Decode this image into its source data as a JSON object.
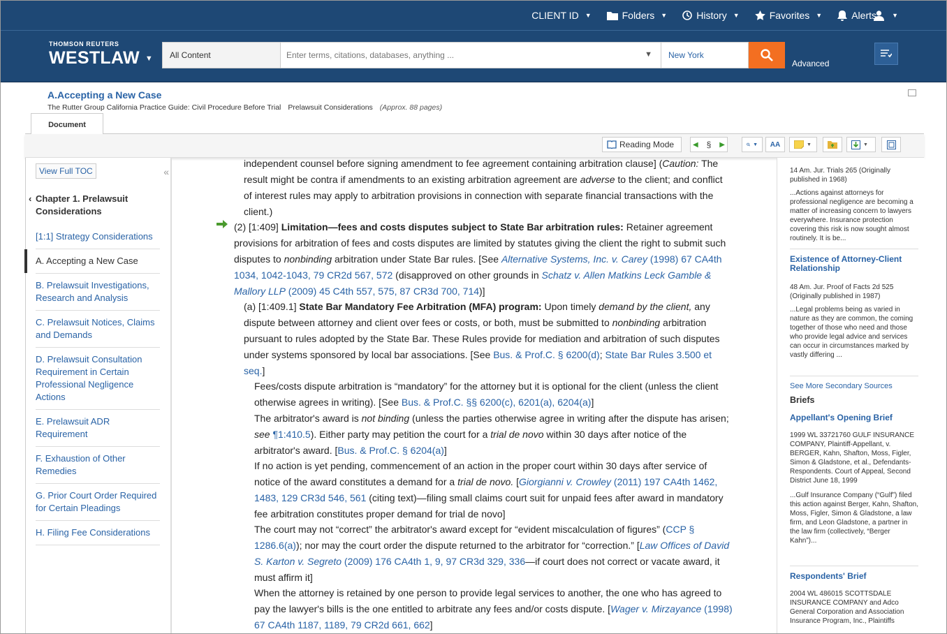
{
  "topnav": {
    "client_id": "CLIENT ID",
    "folders": "Folders",
    "history": "History",
    "favorites": "Favorites",
    "alerts": "Alerts"
  },
  "header": {
    "brand_small": "THOMSON REUTERS",
    "brand_big": "WESTLAW",
    "search_scope": "All Content",
    "search_placeholder": "Enter terms, citations, databases, anything ...",
    "jurisdiction": "New York",
    "advanced": "Advanced"
  },
  "document": {
    "title": "A.Accepting a New Case",
    "source": "The Rutter Group California Practice Guide: Civil Procedure Before Trial",
    "chapter": "Prelawsuit Considerations",
    "pages": "(Approx. 88 pages)",
    "tab": "Document"
  },
  "toolbar": {
    "reading_mode": "Reading Mode",
    "section": "§",
    "font": "AA"
  },
  "toc": {
    "view_full": "View Full TOC",
    "chapter": "Chapter 1. Prelawsuit Considerations",
    "items": [
      "[1:1] Strategy Considerations",
      "A. Accepting a New Case",
      "B. Prelawsuit Investigations, Research and Analysis",
      "C. Prelawsuit Notices, Claims and Demands",
      "D. Prelawsuit Consultation Requirement in Certain Professional Negligence Actions",
      "E. Prelawsuit ADR Requirement",
      "F. Exhaustion of Other Remedies",
      "G. Prior Court Order Required for Certain Pleadings",
      "H. Filing Fee Considerations"
    ]
  },
  "text": {
    "p0a": "independent counsel before signing amendment to fee agreement containing arbitration clause] (",
    "p0b": "Caution:",
    "p0c": " The result might be contra if amendments to an existing arbitration agreement are ",
    "p0d": "adverse",
    "p0e": " to the client; and conflict of interest rules may apply to arbitration provisions in connection with separate financial transactions with the client.)",
    "p1a": "(2) [1:409] ",
    "p1b": "Limitation—fees and costs disputes subject to State Bar arbitration rules:",
    "p1c": " Retainer agreement provisions for arbitration of fees and costs disputes are limited by statutes giving the client the right to submit such disputes to ",
    "p1d": "nonbinding",
    "p1e": " arbitration under State Bar rules. [See ",
    "p1f": "Alternative Systems, Inc. v. Carey",
    "p1g": " (1998) 67 CA4th 1034, 1042-1043, 79 CR2d 567, 572",
    "p1h": " (disapproved on other grounds in ",
    "p1i": "Schatz v. Allen Matkins Leck Gamble & Mallory LLP",
    "p1j": " (2009) 45 C4th 557, 575, 87 CR3d 700, 714",
    "p1k": ")]",
    "p2a": "(a) [1:409.1] ",
    "p2b": "State Bar Mandatory Fee Arbitration (MFA) program:",
    "p2c": " Upon timely ",
    "p2d": "demand by the client,",
    "p2e": " any dispute between attorney and client over fees or costs, or both, must be submitted to ",
    "p2f": "nonbinding",
    "p2g": " arbitration pursuant to rules adopted by the State Bar. These Rules provide for mediation and arbitration of such disputes under systems sponsored by local bar associations. [See ",
    "p2h": "Bus. & Prof.C. § 6200(d)",
    "p2i": "; ",
    "p2j": "State Bar Rules 3.500 et seq.",
    "p2k": "]",
    "p3a": "Fees/costs dispute arbitration is “mandatory” for the attorney but it is optional for the client (unless the client otherwise agrees in writing). [See ",
    "p3b": "Bus. & Prof.C. §§ 6200(c), 6201(a), 6204(a)",
    "p3c": "]",
    "p4a": "The arbitrator's award is ",
    "p4b": "not binding",
    "p4c": " (unless the parties otherwise agree in writing after the dispute has arisen; ",
    "p4d": "see",
    "p4e": " ¶1:410.5",
    "p4f": "). Either party may petition the court for a ",
    "p4g": "trial de novo",
    "p4h": " within 30 days after notice of the arbitrator's award. [",
    "p4i": "Bus. & Prof.C. § 6204(a)",
    "p4j": "]",
    "p5a": "If no action is yet pending, commencement of an action in the proper court within 30 days after service of notice of the award constitutes a demand for a ",
    "p5b": "trial de novo.",
    "p5c": " [",
    "p5d": "Giorgianni v. Crowley",
    "p5e": " (2011) 197 CA4th 1462, 1483, 129 CR3d 546, 561",
    "p5f": " (citing text)—filing small claims court suit for unpaid fees after award in mandatory fee arbitration constitutes proper demand for trial de novo]",
    "p6a": "The court may not “correct” the arbitrator's award except for “evident miscalculation of figures” (",
    "p6b": "CCP § 1286.6(a)",
    "p6c": "); nor may the court order the dispute returned to the arbitrator for “correction.” [",
    "p6d": "Law Offices of David S. Karton v. Segreto",
    "p6e": " (2009) 176 CA4th 1, 9, 97 CR3d 329, 336",
    "p6f": "—if court does not correct or vacate award, it must affirm it]",
    "p7a": "When the attorney is retained by one person to provide legal services to another, the one who has agreed to pay the lawyer's bills is the one entitled to arbitrate any fees and/or costs dispute. [",
    "p7b": "Wager v. Mirzayance",
    "p7c": " (1998) 67 CA4th 1187, 1189, 79 CR2d 661, 662",
    "p7d": "]"
  },
  "right_panel": {
    "r1_cite": "14 Am. Jur. Trials 265 (Originally published in 1968)",
    "r1_snip": "...Actions against attorneys for professional negligence are becoming a matter of increasing concern to lawyers everywhere. Insurance protection covering this risk is now sought almost routinely. It is be...",
    "r2_title": "Existence of Attorney-Client Relationship",
    "r2_cite": "48 Am. Jur. Proof of Facts 2d 525 (Originally published in 1987)",
    "r2_snip": "...Legal problems being as varied in nature as they are common, the coming together of those who need and those who provide legal advice and services can occur in circumstances marked by vastly differing ...",
    "see_more": "See More Secondary Sources",
    "briefs": "Briefs",
    "b1_title": "Appellant's Opening Brief",
    "b1_info": "1999 WL 33721760 GULF INSURANCE COMPANY, Plaintiff-Appellant, v. BERGER, Kahn, Shafton, Moss, Figler, Simon & Gladstone, et al., Defendants-Respondents. Court of Appeal, Second District June 18, 1999",
    "b1_snip": "...Gulf Insurance Company (“Gulf”) filed this action against Berger, Kahn, Shafton, Moss, Figler, Simon & Gladstone, a law firm, and Leon Gladstone, a partner in the law firm (collectively, “Berger Kahn”)...",
    "b2_title": "Respondents' Brief",
    "b2_info": "2004 WL 486015 SCOTTSDALE INSURANCE COMPANY and Adco General Corporation and Association Insurance Program, Inc., Plaintiffs"
  },
  "colors": {
    "brand_blue": "#1e4875",
    "search_orange": "#f36f21",
    "link_blue": "#2a63a6",
    "arrow_green": "#4a9a2e"
  }
}
